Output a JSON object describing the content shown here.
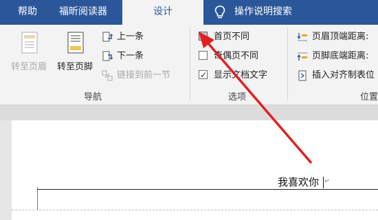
{
  "tabs": {
    "help": "帮助",
    "foxit_reader": "福昕阅读器",
    "design": "设计",
    "tell_me": "操作说明搜索"
  },
  "navigation": {
    "goto_header": "转至页眉",
    "goto_footer": "转至页脚",
    "previous": "上一条",
    "next": "下一条",
    "link_previous": "链接到前一节",
    "group_label": "导航"
  },
  "options": {
    "different_first_page": "首页不同",
    "different_first_page_checked": false,
    "different_odd_even": "奇偶页不同",
    "different_odd_even_checked": false,
    "show_document_text": "显示文档文字",
    "show_document_text_checked": true,
    "group_label": "选项"
  },
  "position": {
    "header_from_top": "页眉顶端距离:",
    "footer_from_bottom": "页脚底端距离:",
    "insert_alignment_tab": "插入对齐制表位",
    "group_label": "位置"
  },
  "document": {
    "header_text": "我喜欢你"
  },
  "colors": {
    "tab_bar": "#2b579a",
    "ribbon": "#f3f3f3",
    "annotation_arrow": "#e02020"
  }
}
